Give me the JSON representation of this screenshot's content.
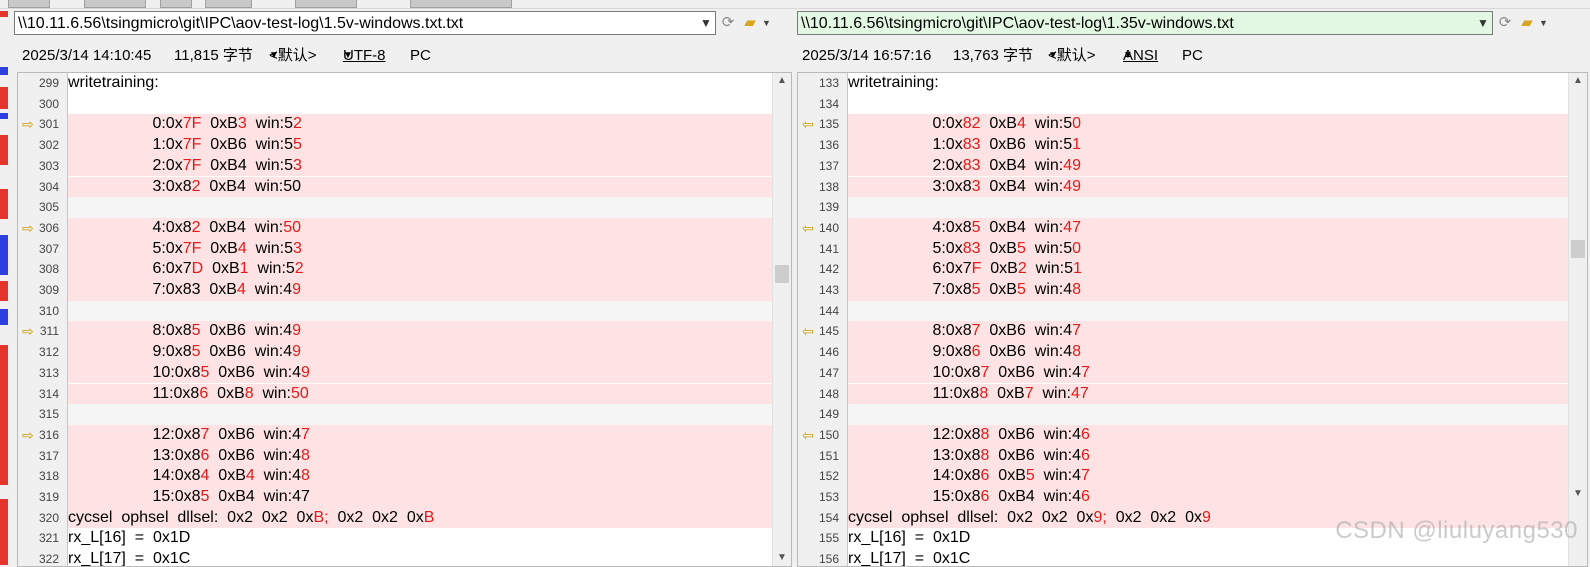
{
  "colors": {
    "diff_bg": "#fde3e3",
    "diff_text": "#e41b1b",
    "path_green": "#e2f8e2",
    "marker": "#d29a00"
  },
  "left": {
    "path": "\\\\10.11.6.56\\tsingmicro\\git\\IPC\\aov-test-log\\1.5v-windows.txt.txt",
    "date": "2025/3/14 14:10:45",
    "size": "11,815 字节",
    "default": "<默认>",
    "encoding": "UTF-8",
    "eol": "PC",
    "lines": [
      {
        "num": "299",
        "type": "plain",
        "segs": [
          {
            "t": "writetraining:"
          }
        ]
      },
      {
        "num": "300",
        "type": "plain",
        "segs": [
          {
            "t": ""
          }
        ]
      },
      {
        "num": "301",
        "type": "diff",
        "mark": "⇨",
        "segs": [
          {
            "t": "                   0:0x"
          },
          {
            "t": "7F",
            "r": true
          },
          {
            "t": "  0xB"
          },
          {
            "t": "3",
            "r": true
          },
          {
            "t": "  win:5"
          },
          {
            "t": "2",
            "r": true
          }
        ]
      },
      {
        "num": "302",
        "type": "diff",
        "segs": [
          {
            "t": "                   1:0x"
          },
          {
            "t": "7F",
            "r": true
          },
          {
            "t": "  0xB6  win:5"
          },
          {
            "t": "5",
            "r": true
          }
        ]
      },
      {
        "num": "303",
        "type": "diff",
        "segs": [
          {
            "t": "                   2:0x"
          },
          {
            "t": "7F",
            "r": true
          },
          {
            "t": "  0xB4  win:5"
          },
          {
            "t": "3",
            "r": true
          }
        ]
      },
      {
        "num": "304",
        "type": "diff",
        "segs": [
          {
            "t": "                   3:0x8"
          },
          {
            "t": "2",
            "r": true
          },
          {
            "t": "  0xB4  win:50"
          }
        ]
      },
      {
        "num": "305",
        "type": "sep",
        "segs": [
          {
            "t": ""
          }
        ]
      },
      {
        "num": "306",
        "type": "diff",
        "mark": "⇨",
        "segs": [
          {
            "t": "                   4:0x8"
          },
          {
            "t": "2",
            "r": true
          },
          {
            "t": "  0xB4  win:"
          },
          {
            "t": "50",
            "r": true
          }
        ]
      },
      {
        "num": "307",
        "type": "diff",
        "segs": [
          {
            "t": "                   5:0x"
          },
          {
            "t": "7F",
            "r": true
          },
          {
            "t": "  0xB"
          },
          {
            "t": "4",
            "r": true
          },
          {
            "t": "  win:5"
          },
          {
            "t": "3",
            "r": true
          }
        ]
      },
      {
        "num": "308",
        "type": "diff",
        "segs": [
          {
            "t": "                   6:0x7"
          },
          {
            "t": "D",
            "r": true
          },
          {
            "t": "  0xB"
          },
          {
            "t": "1",
            "r": true
          },
          {
            "t": "  win:5"
          },
          {
            "t": "2",
            "r": true
          }
        ]
      },
      {
        "num": "309",
        "type": "diff",
        "segs": [
          {
            "t": "                   7:0x83  0xB"
          },
          {
            "t": "4",
            "r": true
          },
          {
            "t": "  win:4"
          },
          {
            "t": "9",
            "r": true
          }
        ]
      },
      {
        "num": "310",
        "type": "sep",
        "segs": [
          {
            "t": ""
          }
        ]
      },
      {
        "num": "311",
        "type": "diff",
        "mark": "⇨",
        "segs": [
          {
            "t": "                   8:0x8"
          },
          {
            "t": "5",
            "r": true
          },
          {
            "t": "  0xB6  win:4"
          },
          {
            "t": "9",
            "r": true
          }
        ]
      },
      {
        "num": "312",
        "type": "diff",
        "segs": [
          {
            "t": "                   9:0x8"
          },
          {
            "t": "5",
            "r": true
          },
          {
            "t": "  0xB6  win:4"
          },
          {
            "t": "9",
            "r": true
          }
        ]
      },
      {
        "num": "313",
        "type": "diff",
        "segs": [
          {
            "t": "                   10:0x8"
          },
          {
            "t": "5",
            "r": true
          },
          {
            "t": "  0xB6  win:4"
          },
          {
            "t": "9",
            "r": true
          }
        ]
      },
      {
        "num": "314",
        "type": "diff",
        "segs": [
          {
            "t": "                   11:0x8"
          },
          {
            "t": "6",
            "r": true
          },
          {
            "t": "  0xB"
          },
          {
            "t": "8",
            "r": true
          },
          {
            "t": "  win:"
          },
          {
            "t": "50",
            "r": true
          }
        ]
      },
      {
        "num": "315",
        "type": "sep",
        "segs": [
          {
            "t": ""
          }
        ]
      },
      {
        "num": "316",
        "type": "diff",
        "mark": "⇨",
        "segs": [
          {
            "t": "                   12:0x8"
          },
          {
            "t": "7",
            "r": true
          },
          {
            "t": "  0xB6  win:4"
          },
          {
            "t": "7",
            "r": true
          }
        ]
      },
      {
        "num": "317",
        "type": "diff",
        "segs": [
          {
            "t": "                   13:0x8"
          },
          {
            "t": "6",
            "r": true
          },
          {
            "t": "  0xB6  win:4"
          },
          {
            "t": "8",
            "r": true
          }
        ]
      },
      {
        "num": "318",
        "type": "diff",
        "segs": [
          {
            "t": "                   14:0x8"
          },
          {
            "t": "4",
            "r": true
          },
          {
            "t": "  0xB"
          },
          {
            "t": "4",
            "r": true
          },
          {
            "t": "  win:4"
          },
          {
            "t": "8",
            "r": true
          }
        ]
      },
      {
        "num": "319",
        "type": "diff",
        "segs": [
          {
            "t": "                   15:0x8"
          },
          {
            "t": "5",
            "r": true
          },
          {
            "t": "  0xB4  win:47"
          }
        ]
      },
      {
        "num": "320",
        "type": "diff",
        "segs": [
          {
            "t": "cycsel  ophsel  dllsel:  0x2  0x2  0x"
          },
          {
            "t": "B",
            "r": true
          },
          {
            "t": ";",
            "r": true
          },
          {
            "t": "  0x2  0x2  0x"
          },
          {
            "t": "B",
            "r": true
          }
        ]
      },
      {
        "num": "321",
        "type": "plain",
        "segs": [
          {
            "t": "rx_L[16]  =  0x1D"
          }
        ]
      },
      {
        "num": "322",
        "type": "plain",
        "segs": [
          {
            "t": "rx_L[17]  =  0x1C"
          }
        ]
      }
    ]
  },
  "right": {
    "path": "\\\\10.11.6.56\\tsingmicro\\git\\IPC\\aov-test-log\\1.35v-windows.txt",
    "date": "2025/3/14 16:57:16",
    "size": "13,763 字节",
    "default": "<默认>",
    "encoding": "ANSI",
    "eol": "PC",
    "lines": [
      {
        "num": "133",
        "type": "plain",
        "segs": [
          {
            "t": "writetraining:"
          }
        ]
      },
      {
        "num": "134",
        "type": "plain",
        "segs": [
          {
            "t": ""
          }
        ]
      },
      {
        "num": "135",
        "type": "diff",
        "mark": "⇦",
        "segs": [
          {
            "t": "                   0:0x"
          },
          {
            "t": "82",
            "r": true
          },
          {
            "t": "  0xB"
          },
          {
            "t": "4",
            "r": true
          },
          {
            "t": "  win:5"
          },
          {
            "t": "0",
            "r": true
          }
        ]
      },
      {
        "num": "136",
        "type": "diff",
        "segs": [
          {
            "t": "                   1:0x"
          },
          {
            "t": "83",
            "r": true
          },
          {
            "t": "  0xB6  win:5"
          },
          {
            "t": "1",
            "r": true
          }
        ]
      },
      {
        "num": "137",
        "type": "diff",
        "segs": [
          {
            "t": "                   2:0x"
          },
          {
            "t": "83",
            "r": true
          },
          {
            "t": "  0xB4  win:"
          },
          {
            "t": "49",
            "r": true
          }
        ]
      },
      {
        "num": "138",
        "type": "diff",
        "segs": [
          {
            "t": "                   3:0x8"
          },
          {
            "t": "3",
            "r": true
          },
          {
            "t": "  0xB4  win:"
          },
          {
            "t": "49",
            "r": true
          }
        ]
      },
      {
        "num": "139",
        "type": "sep",
        "segs": [
          {
            "t": ""
          }
        ]
      },
      {
        "num": "140",
        "type": "diff",
        "mark": "⇦",
        "segs": [
          {
            "t": "                   4:0x8"
          },
          {
            "t": "5",
            "r": true
          },
          {
            "t": "  0xB4  win:"
          },
          {
            "t": "47",
            "r": true
          }
        ]
      },
      {
        "num": "141",
        "type": "diff",
        "segs": [
          {
            "t": "                   5:0x"
          },
          {
            "t": "83",
            "r": true
          },
          {
            "t": "  0xB"
          },
          {
            "t": "5",
            "r": true
          },
          {
            "t": "  win:5"
          },
          {
            "t": "0",
            "r": true
          }
        ]
      },
      {
        "num": "142",
        "type": "diff",
        "segs": [
          {
            "t": "                   6:0x7"
          },
          {
            "t": "F",
            "r": true
          },
          {
            "t": "  0xB"
          },
          {
            "t": "2",
            "r": true
          },
          {
            "t": "  win:5"
          },
          {
            "t": "1",
            "r": true
          }
        ]
      },
      {
        "num": "143",
        "type": "diff",
        "segs": [
          {
            "t": "                   7:0x8"
          },
          {
            "t": "5",
            "r": true
          },
          {
            "t": "  0xB"
          },
          {
            "t": "5",
            "r": true
          },
          {
            "t": "  win:4"
          },
          {
            "t": "8",
            "r": true
          }
        ]
      },
      {
        "num": "144",
        "type": "sep",
        "segs": [
          {
            "t": ""
          }
        ]
      },
      {
        "num": "145",
        "type": "diff",
        "mark": "⇦",
        "segs": [
          {
            "t": "                   8:0x8"
          },
          {
            "t": "7",
            "r": true
          },
          {
            "t": "  0xB6  win:4"
          },
          {
            "t": "7",
            "r": true
          }
        ]
      },
      {
        "num": "146",
        "type": "diff",
        "segs": [
          {
            "t": "                   9:0x8"
          },
          {
            "t": "6",
            "r": true
          },
          {
            "t": "  0xB6  win:4"
          },
          {
            "t": "8",
            "r": true
          }
        ]
      },
      {
        "num": "147",
        "type": "diff",
        "segs": [
          {
            "t": "                   10:0x8"
          },
          {
            "t": "7",
            "r": true
          },
          {
            "t": "  0xB6  win:4"
          },
          {
            "t": "7",
            "r": true
          }
        ]
      },
      {
        "num": "148",
        "type": "diff",
        "segs": [
          {
            "t": "                   11:0x8"
          },
          {
            "t": "8",
            "r": true
          },
          {
            "t": "  0xB"
          },
          {
            "t": "7",
            "r": true
          },
          {
            "t": "  win:"
          },
          {
            "t": "47",
            "r": true
          }
        ]
      },
      {
        "num": "149",
        "type": "sep",
        "segs": [
          {
            "t": ""
          }
        ]
      },
      {
        "num": "150",
        "type": "diff",
        "mark": "⇦",
        "segs": [
          {
            "t": "                   12:0x8"
          },
          {
            "t": "8",
            "r": true
          },
          {
            "t": "  0xB6  win:4"
          },
          {
            "t": "6",
            "r": true
          }
        ]
      },
      {
        "num": "151",
        "type": "diff",
        "segs": [
          {
            "t": "                   13:0x8"
          },
          {
            "t": "8",
            "r": true
          },
          {
            "t": "  0xB6  win:4"
          },
          {
            "t": "6",
            "r": true
          }
        ]
      },
      {
        "num": "152",
        "type": "diff",
        "segs": [
          {
            "t": "                   14:0x8"
          },
          {
            "t": "6",
            "r": true
          },
          {
            "t": "  0xB"
          },
          {
            "t": "5",
            "r": true
          },
          {
            "t": "  win:4"
          },
          {
            "t": "7",
            "r": true
          }
        ]
      },
      {
        "num": "153",
        "type": "diff",
        "segs": [
          {
            "t": "                   15:0x8"
          },
          {
            "t": "6",
            "r": true
          },
          {
            "t": "  0xB4  win:4"
          },
          {
            "t": "6",
            "r": true
          }
        ]
      },
      {
        "num": "154",
        "type": "diff",
        "segs": [
          {
            "t": "cycsel  ophsel  dllsel:  0x2  0x2  0x"
          },
          {
            "t": "9",
            "r": true
          },
          {
            "t": ";",
            "r": true
          },
          {
            "t": "  0x2  0x2  0x"
          },
          {
            "t": "9",
            "r": true
          }
        ]
      },
      {
        "num": "155",
        "type": "plain",
        "segs": [
          {
            "t": "rx_L[16]  =  0x1D"
          }
        ]
      },
      {
        "num": "156",
        "type": "plain",
        "segs": [
          {
            "t": "rx_L[17]  =  0x1C"
          }
        ]
      }
    ]
  },
  "icons": {
    "reload": "reload-icon",
    "open_folder": "open-folder-icon",
    "dropdown": "chevron-down-icon",
    "scroll_up": "scroll-up-icon",
    "scroll_down": "scroll-down-icon"
  },
  "watermark": "CSDN @liuluyang530"
}
